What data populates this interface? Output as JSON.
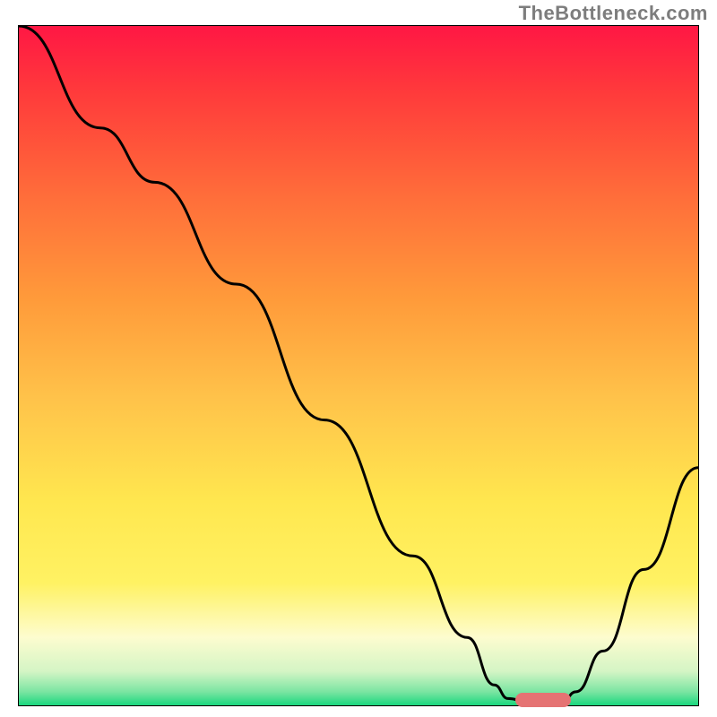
{
  "watermark": "TheBottleneck.com",
  "chart_data": {
    "type": "line",
    "title": "",
    "xlabel": "",
    "ylabel": "",
    "xlim": [
      0,
      100
    ],
    "ylim": [
      0,
      100
    ],
    "gradient_stops": [
      {
        "offset": 0,
        "color": "#ff1744"
      },
      {
        "offset": 10,
        "color": "#ff3b3b"
      },
      {
        "offset": 25,
        "color": "#ff6d3a"
      },
      {
        "offset": 40,
        "color": "#ff9a3a"
      },
      {
        "offset": 55,
        "color": "#ffc34a"
      },
      {
        "offset": 70,
        "color": "#ffe74f"
      },
      {
        "offset": 82,
        "color": "#fff263"
      },
      {
        "offset": 90,
        "color": "#fdfccf"
      },
      {
        "offset": 95,
        "color": "#d4f5c5"
      },
      {
        "offset": 98,
        "color": "#7be5a2"
      },
      {
        "offset": 100,
        "color": "#19d77e"
      }
    ],
    "series": [
      {
        "name": "bottleneck-curve",
        "points": [
          {
            "x": 0,
            "y": 100
          },
          {
            "x": 12,
            "y": 85
          },
          {
            "x": 20,
            "y": 77
          },
          {
            "x": 32,
            "y": 62
          },
          {
            "x": 45,
            "y": 42
          },
          {
            "x": 58,
            "y": 22
          },
          {
            "x": 66,
            "y": 10
          },
          {
            "x": 70,
            "y": 3
          },
          {
            "x": 72,
            "y": 1
          },
          {
            "x": 75,
            "y": 0.5
          },
          {
            "x": 80,
            "y": 0.5
          },
          {
            "x": 82,
            "y": 2
          },
          {
            "x": 86,
            "y": 8
          },
          {
            "x": 92,
            "y": 20
          },
          {
            "x": 100,
            "y": 35
          }
        ]
      }
    ],
    "marker": {
      "x": 77,
      "y": 1,
      "color": "#e57373"
    }
  }
}
